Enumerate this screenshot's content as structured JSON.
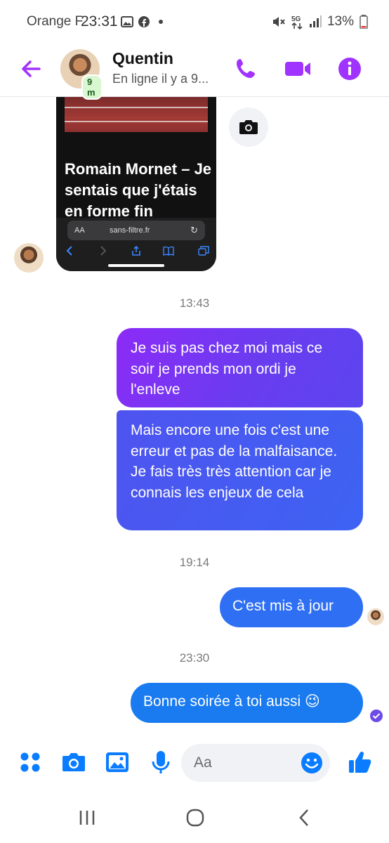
{
  "status_bar": {
    "carrier": "Orange F",
    "time": "23:31",
    "battery": "13%",
    "network": "5G"
  },
  "header": {
    "contact_name": "Quentin",
    "presence_badge": "9 m",
    "status": "En ligne il y a 9..."
  },
  "shared_card": {
    "title": "Romain Mornet – Je sentais que j'étais en forme fin",
    "browser_aa": "AA",
    "url": "sans-filtre.fr"
  },
  "messages": [
    {
      "time": "13:43"
    },
    {
      "text": "Je suis pas chez moi mais ce soir je prends mon ordi je l'enleve"
    },
    {
      "text": "Mais encore une fois c'est une erreur et pas de la malfaisance. Je fais très très attention car je connais les enjeux de cela"
    },
    {
      "time": "19:14"
    },
    {
      "text": "C'est mis à jour"
    },
    {
      "time": "23:30"
    },
    {
      "text": "Bonne soirée à toi aussi 😉"
    }
  ],
  "composer": {
    "placeholder": "Aa"
  },
  "colors": {
    "accent": "#a033ff",
    "blue": "#0a7cff"
  }
}
